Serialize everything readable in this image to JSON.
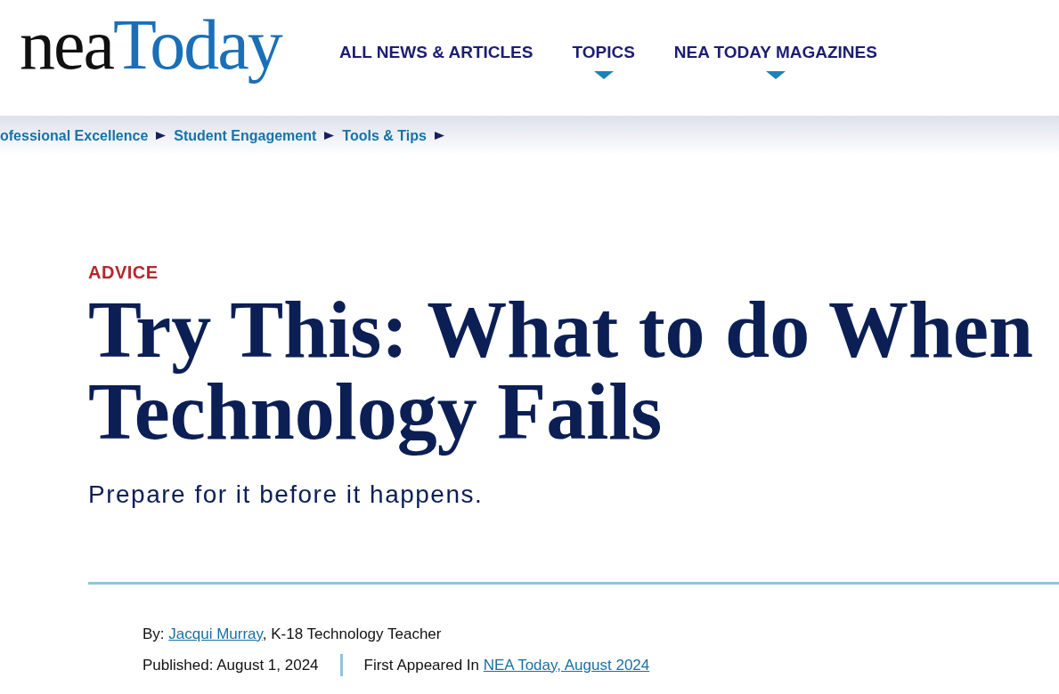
{
  "logo": {
    "prefix": "nea",
    "wordmark": "Today"
  },
  "nav": [
    {
      "label": "ALL NEWS & ARTICLES",
      "dropdown": false
    },
    {
      "label": "TOPICS",
      "dropdown": true
    },
    {
      "label": "NEA TODAY MAGAZINES",
      "dropdown": true
    }
  ],
  "breadcrumb": [
    "ofessional Excellence",
    "Student Engagement",
    "Tools & Tips"
  ],
  "article": {
    "category": "ADVICE",
    "title": "Try This: What to do When Technology Fails",
    "subtitle": "Prepare for it before it happens.",
    "byline": {
      "label": "By:",
      "author": "Jacqui Murray",
      "role": ", K-18 Technology Teacher"
    },
    "published": {
      "label": "Published:",
      "date": "August 1, 2024"
    },
    "first_appeared": {
      "label": "First Appeared In",
      "source": "NEA Today, August 2024"
    }
  }
}
